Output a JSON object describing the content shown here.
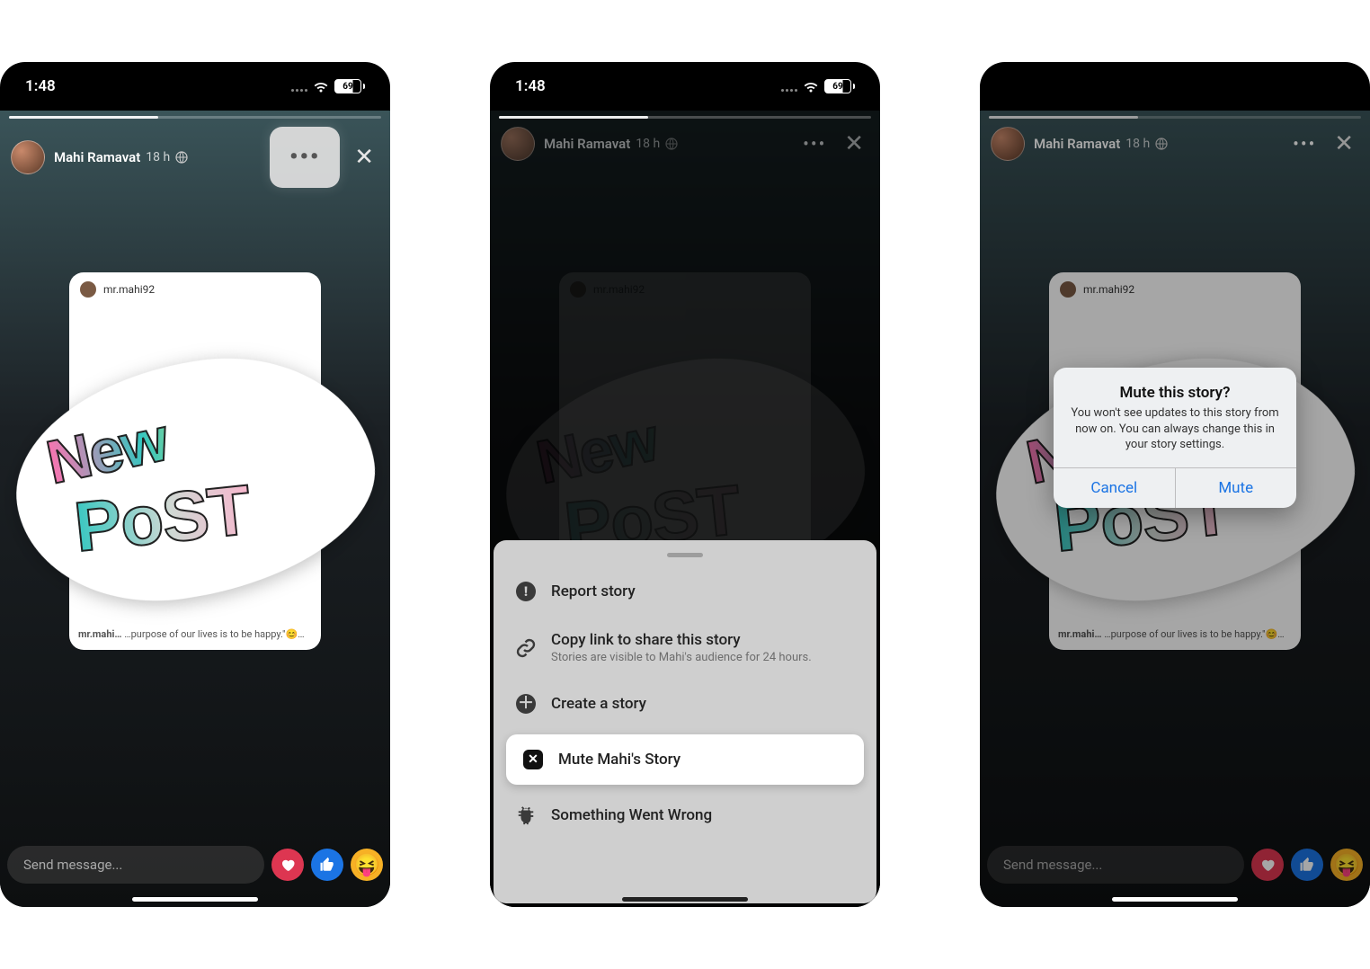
{
  "status": {
    "time": "1:48",
    "battery": "69"
  },
  "story": {
    "user_name": "Mahi Ramavat",
    "age": "18 h",
    "card_handle": "mr.mahi92",
    "caption_prefix": "mr.mahi…",
    "caption_rest": " …purpose of our lives is to be happy.\"😊…",
    "sticker_line1": "New",
    "sticker_line2": "PoST"
  },
  "msg": {
    "placeholder": "Send message..."
  },
  "sheet": {
    "report": "Report story",
    "copy_title": "Copy link to share this story",
    "copy_sub": "Stories are visible to Mahi's audience for 24 hours.",
    "create": "Create a story",
    "mute": "Mute Mahi's Story",
    "wrong": "Something Went Wrong"
  },
  "alert": {
    "title": "Mute this story?",
    "msg": "You won't see updates to this story from now on. You can always change this in your story settings.",
    "cancel": "Cancel",
    "mute": "Mute"
  }
}
